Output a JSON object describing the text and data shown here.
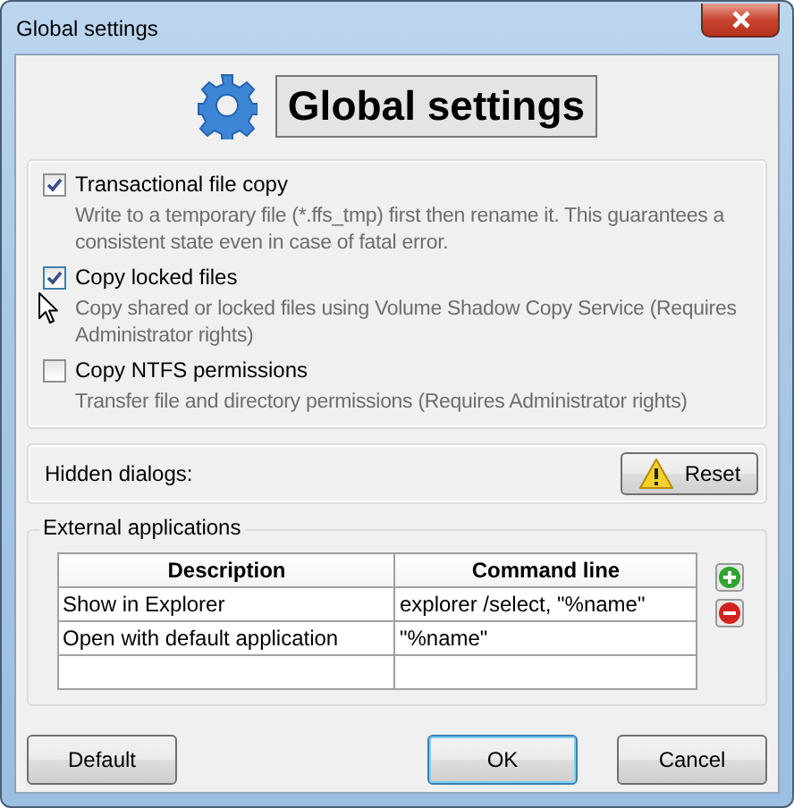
{
  "window": {
    "title": "Global settings"
  },
  "header": {
    "title": "Global settings"
  },
  "options": [
    {
      "label": "Transactional file copy",
      "checked": true,
      "description": "Write to a temporary file (*.ffs_tmp) first then rename it. This guarantees a consistent state even in case of fatal error."
    },
    {
      "label": "Copy locked files",
      "checked": true,
      "description": "Copy shared or locked files using Volume Shadow Copy Service (Requires Administrator rights)"
    },
    {
      "label": "Copy NTFS permissions",
      "checked": false,
      "description": "Transfer file and directory permissions (Requires Administrator rights)"
    }
  ],
  "hidden_dialogs": {
    "label": "Hidden dialogs:",
    "button": "Reset"
  },
  "external_applications": {
    "title": "External applications",
    "columns": [
      "Description",
      "Command line"
    ],
    "rows": [
      [
        "Show in Explorer",
        "explorer /select, \"%name\""
      ],
      [
        "Open with default application",
        "\"%name\""
      ]
    ]
  },
  "buttons": [
    {
      "label": "Default",
      "kind": "default"
    },
    {
      "label": "OK",
      "kind": "primary"
    },
    {
      "label": "Cancel",
      "kind": "cancel"
    }
  ]
}
